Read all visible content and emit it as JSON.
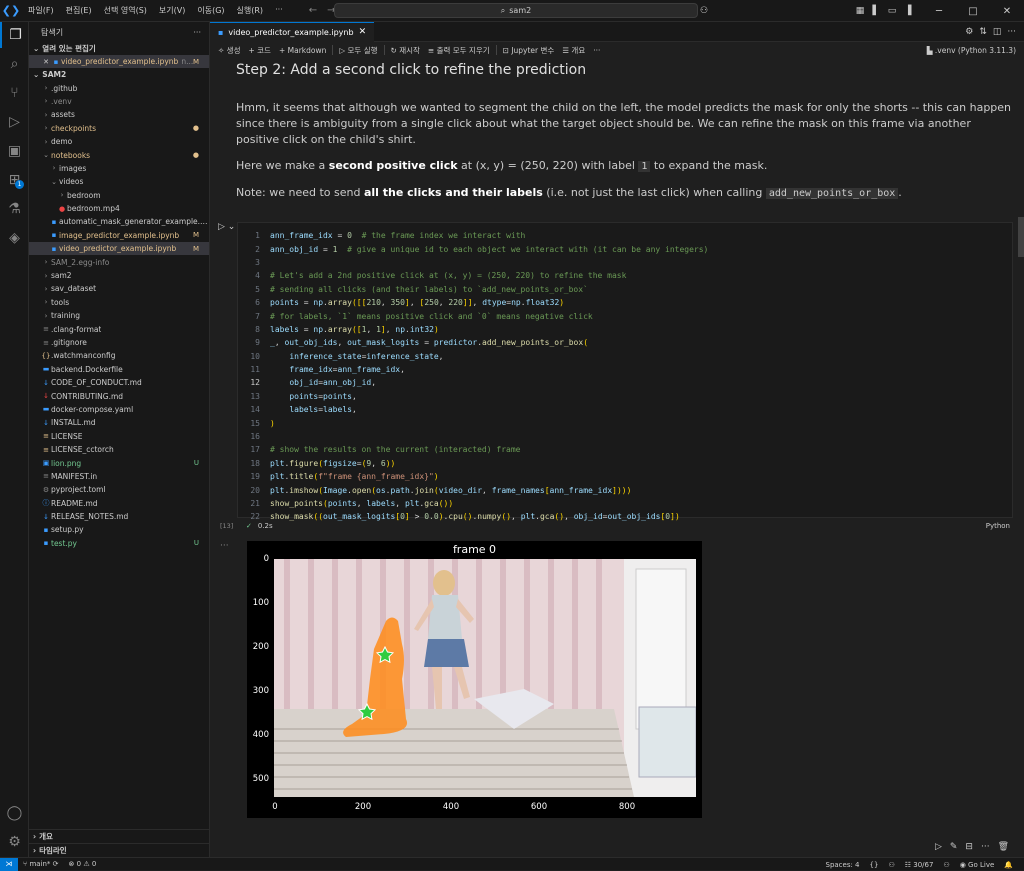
{
  "titlebar": {
    "menus": [
      "파일(F)",
      "편집(E)",
      "선택 영역(S)",
      "보기(V)",
      "이동(G)",
      "실행(R)",
      "···"
    ],
    "search": "sam2"
  },
  "activity": {
    "extensions_badge": "1"
  },
  "sidebar": {
    "title": "탐색기",
    "open_editors_label": "열려 있는 편집기",
    "open_editor": {
      "name": "video_predictor_example.ipynb",
      "suffix": "n...",
      "deco": "M"
    },
    "project_label": "SAM2",
    "items": [
      {
        "name": ".github",
        "type": "folder",
        "depth": 1,
        "color": "normal"
      },
      {
        "name": ".venv",
        "type": "folder",
        "depth": 1,
        "color": "dim"
      },
      {
        "name": "assets",
        "type": "folder",
        "depth": 1,
        "color": "normal"
      },
      {
        "name": "checkpoints",
        "type": "folder",
        "depth": 1,
        "color": "mod",
        "deco": "●"
      },
      {
        "name": "demo",
        "type": "folder",
        "depth": 1,
        "color": "normal"
      },
      {
        "name": "notebooks",
        "type": "folder-open",
        "depth": 1,
        "color": "mod",
        "deco": "●"
      },
      {
        "name": "images",
        "type": "folder",
        "depth": 2,
        "color": "normal"
      },
      {
        "name": "videos",
        "type": "folder-open",
        "depth": 2,
        "color": "normal"
      },
      {
        "name": "bedroom",
        "type": "folder",
        "depth": 3,
        "color": "normal"
      },
      {
        "name": "bedroom.mp4",
        "type": "mp4",
        "depth": 3,
        "color": "normal"
      },
      {
        "name": "automatic_mask_generator_example.ipynb",
        "type": "nb",
        "depth": 2,
        "color": "normal"
      },
      {
        "name": "image_predictor_example.ipynb",
        "type": "nb",
        "depth": 2,
        "color": "mod",
        "deco": "M"
      },
      {
        "name": "video_predictor_example.ipynb",
        "type": "nb",
        "depth": 2,
        "color": "mod",
        "deco": "M",
        "selected": true
      },
      {
        "name": "SAM_2.egg-info",
        "type": "folder",
        "depth": 1,
        "color": "dim"
      },
      {
        "name": "sam2",
        "type": "folder",
        "depth": 1,
        "color": "normal"
      },
      {
        "name": "sav_dataset",
        "type": "folder",
        "depth": 1,
        "color": "normal"
      },
      {
        "name": "tools",
        "type": "folder",
        "depth": 1,
        "color": "normal"
      },
      {
        "name": "training",
        "type": "folder",
        "depth": 1,
        "color": "normal"
      },
      {
        "name": ".clang-format",
        "type": "file",
        "depth": 1,
        "color": "normal"
      },
      {
        "name": ".gitignore",
        "type": "file",
        "depth": 1,
        "color": "normal"
      },
      {
        "name": ".watchmanconfig",
        "type": "json",
        "depth": 1,
        "color": "normal"
      },
      {
        "name": "backend.Dockerfile",
        "type": "docker",
        "depth": 1,
        "color": "normal"
      },
      {
        "name": "CODE_OF_CONDUCT.md",
        "type": "md",
        "depth": 1,
        "color": "normal"
      },
      {
        "name": "CONTRIBUTING.md",
        "type": "md-red",
        "depth": 1,
        "color": "normal"
      },
      {
        "name": "docker-compose.yaml",
        "type": "docker",
        "depth": 1,
        "color": "normal"
      },
      {
        "name": "INSTALL.md",
        "type": "md",
        "depth": 1,
        "color": "normal"
      },
      {
        "name": "LICENSE",
        "type": "license",
        "depth": 1,
        "color": "normal"
      },
      {
        "name": "LICENSE_cctorch",
        "type": "license",
        "depth": 1,
        "color": "normal"
      },
      {
        "name": "lion.png",
        "type": "img",
        "depth": 1,
        "color": "new",
        "deco": "U"
      },
      {
        "name": "MANIFEST.in",
        "type": "file",
        "depth": 1,
        "color": "normal"
      },
      {
        "name": "pyproject.toml",
        "type": "gear",
        "depth": 1,
        "color": "normal"
      },
      {
        "name": "README.md",
        "type": "info",
        "depth": 1,
        "color": "normal"
      },
      {
        "name": "RELEASE_NOTES.md",
        "type": "md",
        "depth": 1,
        "color": "normal"
      },
      {
        "name": "setup.py",
        "type": "py",
        "depth": 1,
        "color": "normal"
      },
      {
        "name": "test.py",
        "type": "py",
        "depth": 1,
        "color": "new",
        "deco": "U"
      }
    ],
    "outline_label": "개요",
    "timeline_label": "타임라인"
  },
  "editor": {
    "tab_label": "video_predictor_example.ipynb",
    "toolbar": [
      "생성",
      "코드",
      "Markdown",
      "모두 실행",
      "재시작",
      "출력 모두 지우기",
      "Jupyter 변수",
      "개요",
      "···"
    ],
    "kernel": ".venv (Python 3.11.3)",
    "heading": "Step 2: Add a second click to refine the prediction",
    "para1": "Hmm, it seems that although we wanted to segment the child on the left, the model predicts the mask for only the shorts -- this can happen since there is ambiguity from a single click about what the target object should be. We can refine the mask on this frame via another positive click on the child's shirt.",
    "para2_a": "Here we make a ",
    "para2_b": "second positive click",
    "para2_c": " at (x, y) = (250, 220) with label ",
    "para2_code": "1",
    "para2_d": " to expand the mask.",
    "para3_a": "Note: we need to send ",
    "para3_b": "all the clicks and their labels",
    "para3_c": " (i.e. not just the last click) when calling ",
    "para3_code": "add_new_points_or_box",
    "para3_d": ".",
    "cell": {
      "exec_count": "[13]",
      "duration": "0.2s",
      "language": "Python",
      "current_line": 12,
      "lines": [
        "ann_frame_idx = 0  # the frame index we interact with",
        "ann_obj_id = 1  # give a unique id to each object we interact with (it can be any integers)",
        "",
        "# Let's add a 2nd positive click at (x, y) = (250, 220) to refine the mask",
        "# sending all clicks (and their labels) to `add_new_points_or_box`",
        "points = np.array([[210, 350], [250, 220]], dtype=np.float32)",
        "# for labels, `1` means positive click and `0` means negative click",
        "labels = np.array([1, 1], np.int32)",
        "_, out_obj_ids, out_mask_logits = predictor.add_new_points_or_box(",
        "    inference_state=inference_state,",
        "    frame_idx=ann_frame_idx,",
        "    obj_id=ann_obj_id,",
        "    points=points,",
        "    labels=labels,",
        ")",
        "",
        "# show the results on the current (interacted) frame",
        "plt.figure(figsize=(9, 6))",
        "plt.title(f\"frame {ann_frame_idx}\")",
        "plt.imshow(Image.open(os.path.join(video_dir, frame_names[ann_frame_idx])))",
        "show_points(points, labels, plt.gca())",
        "show_mask((out_mask_logits[0] > 0.0).cpu().numpy(), plt.gca(), obj_id=out_obj_ids[0])"
      ]
    },
    "output": {
      "title": "frame 0",
      "yticks": [
        "0",
        "100",
        "200",
        "300",
        "400",
        "500"
      ],
      "xticks": [
        "0",
        "200",
        "400",
        "600",
        "800"
      ]
    }
  },
  "statusbar": {
    "branch": "main*",
    "errors": "0",
    "warnings": "0",
    "spaces": "Spaces: 4",
    "cells": "30/67",
    "golive": "Go Live"
  }
}
